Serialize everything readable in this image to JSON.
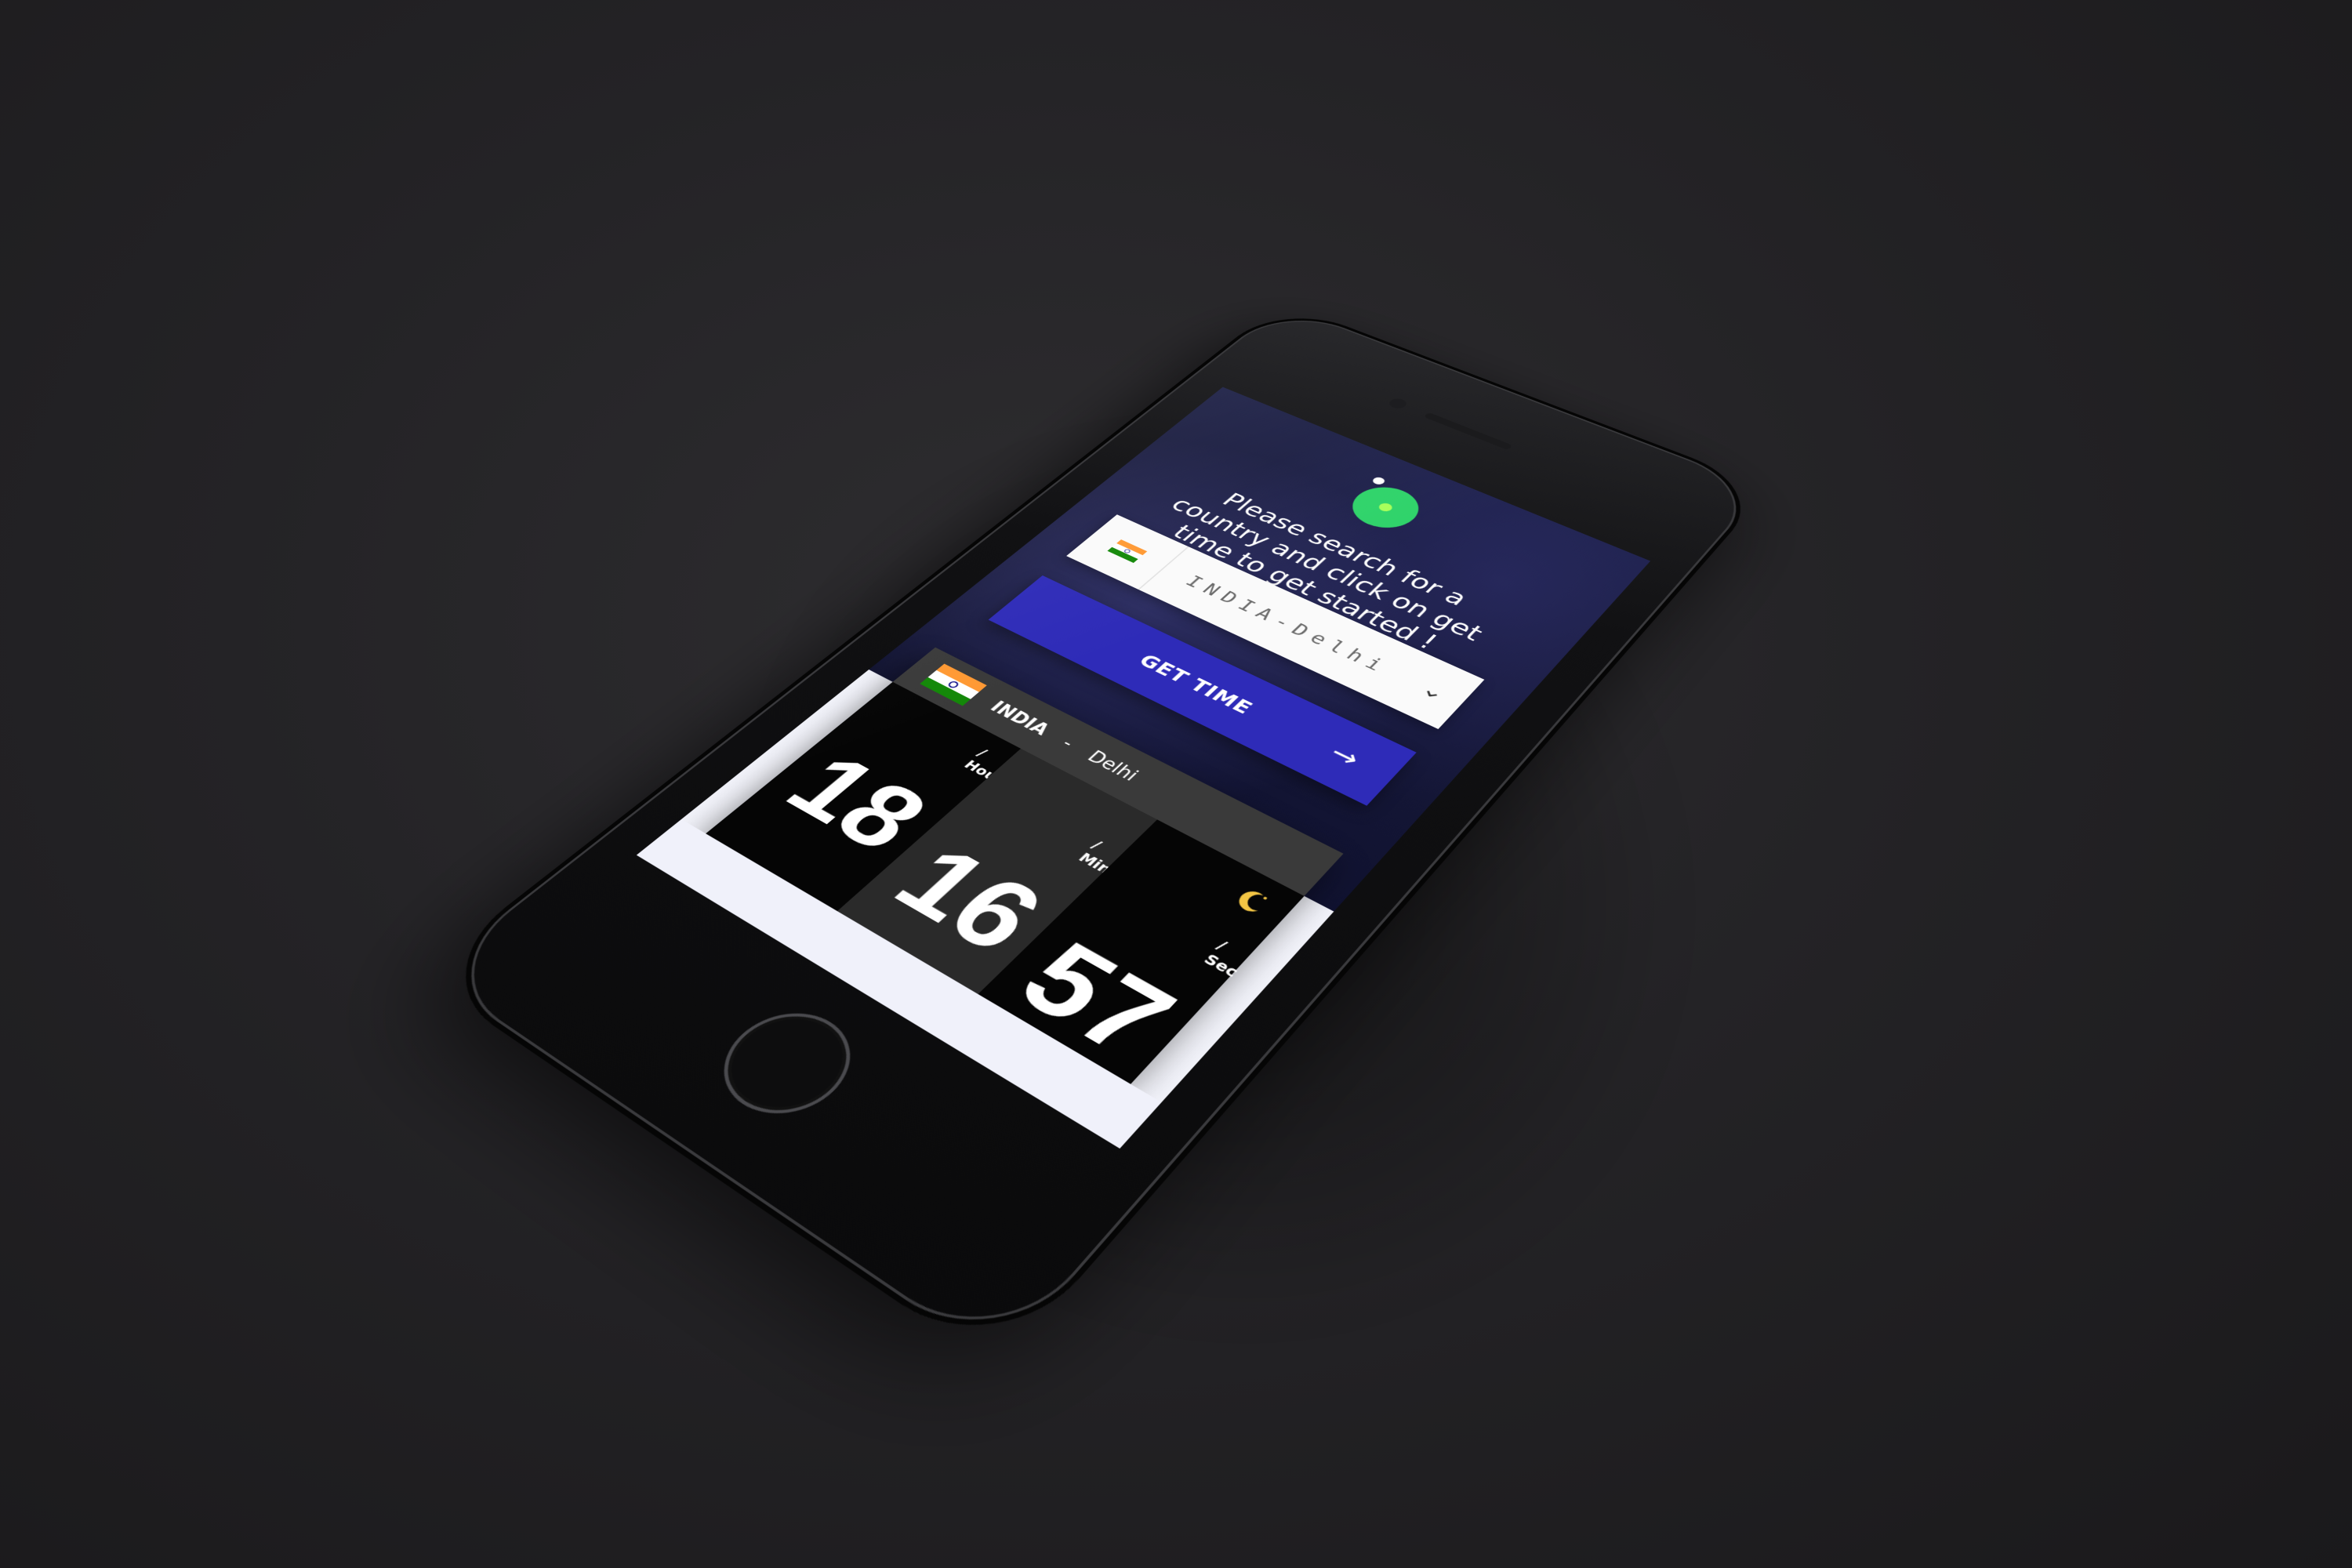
{
  "app": {
    "intro_text": "Please search for a country and click on get time to get started !"
  },
  "search": {
    "selected_value": "INDIA-Delhi",
    "flag_icon": "india-flag-icon",
    "chevron_icon": "chevron-down-icon"
  },
  "cta": {
    "label": "GET TIME",
    "arrow_icon": "arrow-right-icon"
  },
  "clock": {
    "country": "INDIA",
    "separator": "-",
    "city": "Delhi",
    "hour": "18",
    "hour_unit": "/ Hour",
    "minute": "16",
    "minute_unit": "/ Min",
    "second": "57",
    "second_unit": "/ Sec",
    "period_icon": "moon-icon"
  },
  "colors": {
    "accent": "#2e2bb8",
    "logo": "#2fd36a",
    "hero_bg": "#181a3b",
    "clock_dark": "#050505",
    "clock_mid": "#2a2a2a"
  }
}
